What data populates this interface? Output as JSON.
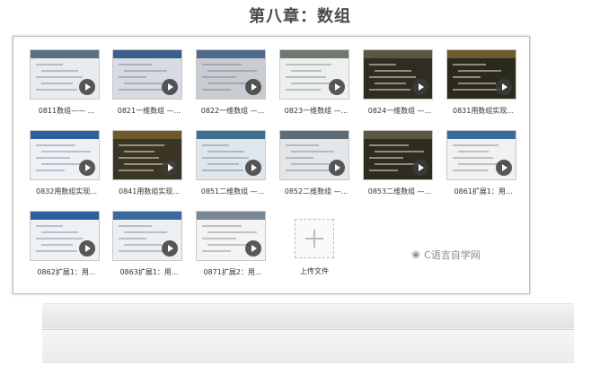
{
  "page": {
    "title": "第八章：数组"
  },
  "videos": [
    {
      "label": "0811数组—— ..."
    },
    {
      "label": "0821一维数组 —..."
    },
    {
      "label": "0822一维数组 —..."
    },
    {
      "label": "0823一维数组 —..."
    },
    {
      "label": "0824一维数组 —..."
    },
    {
      "label": "0831用数组实现..."
    },
    {
      "label": "0832用数组实现..."
    },
    {
      "label": "0841用数组实现..."
    },
    {
      "label": "0851二维数组 —..."
    },
    {
      "label": "0852二维数组 —..."
    },
    {
      "label": "0853二维数组 —..."
    },
    {
      "label": "0861扩展1：用..."
    },
    {
      "label": "0862扩展1：用..."
    },
    {
      "label": "0863扩展1：用..."
    },
    {
      "label": "0871扩展2：用..."
    }
  ],
  "upload": {
    "label": "上传文件"
  },
  "watermark": {
    "text": "C语言自学网"
  },
  "colors": {
    "accent_dark_board": "#2b2a1e",
    "accent_blue_bar": "#2f5f9e",
    "accent_gray": "#9aa3ad"
  }
}
